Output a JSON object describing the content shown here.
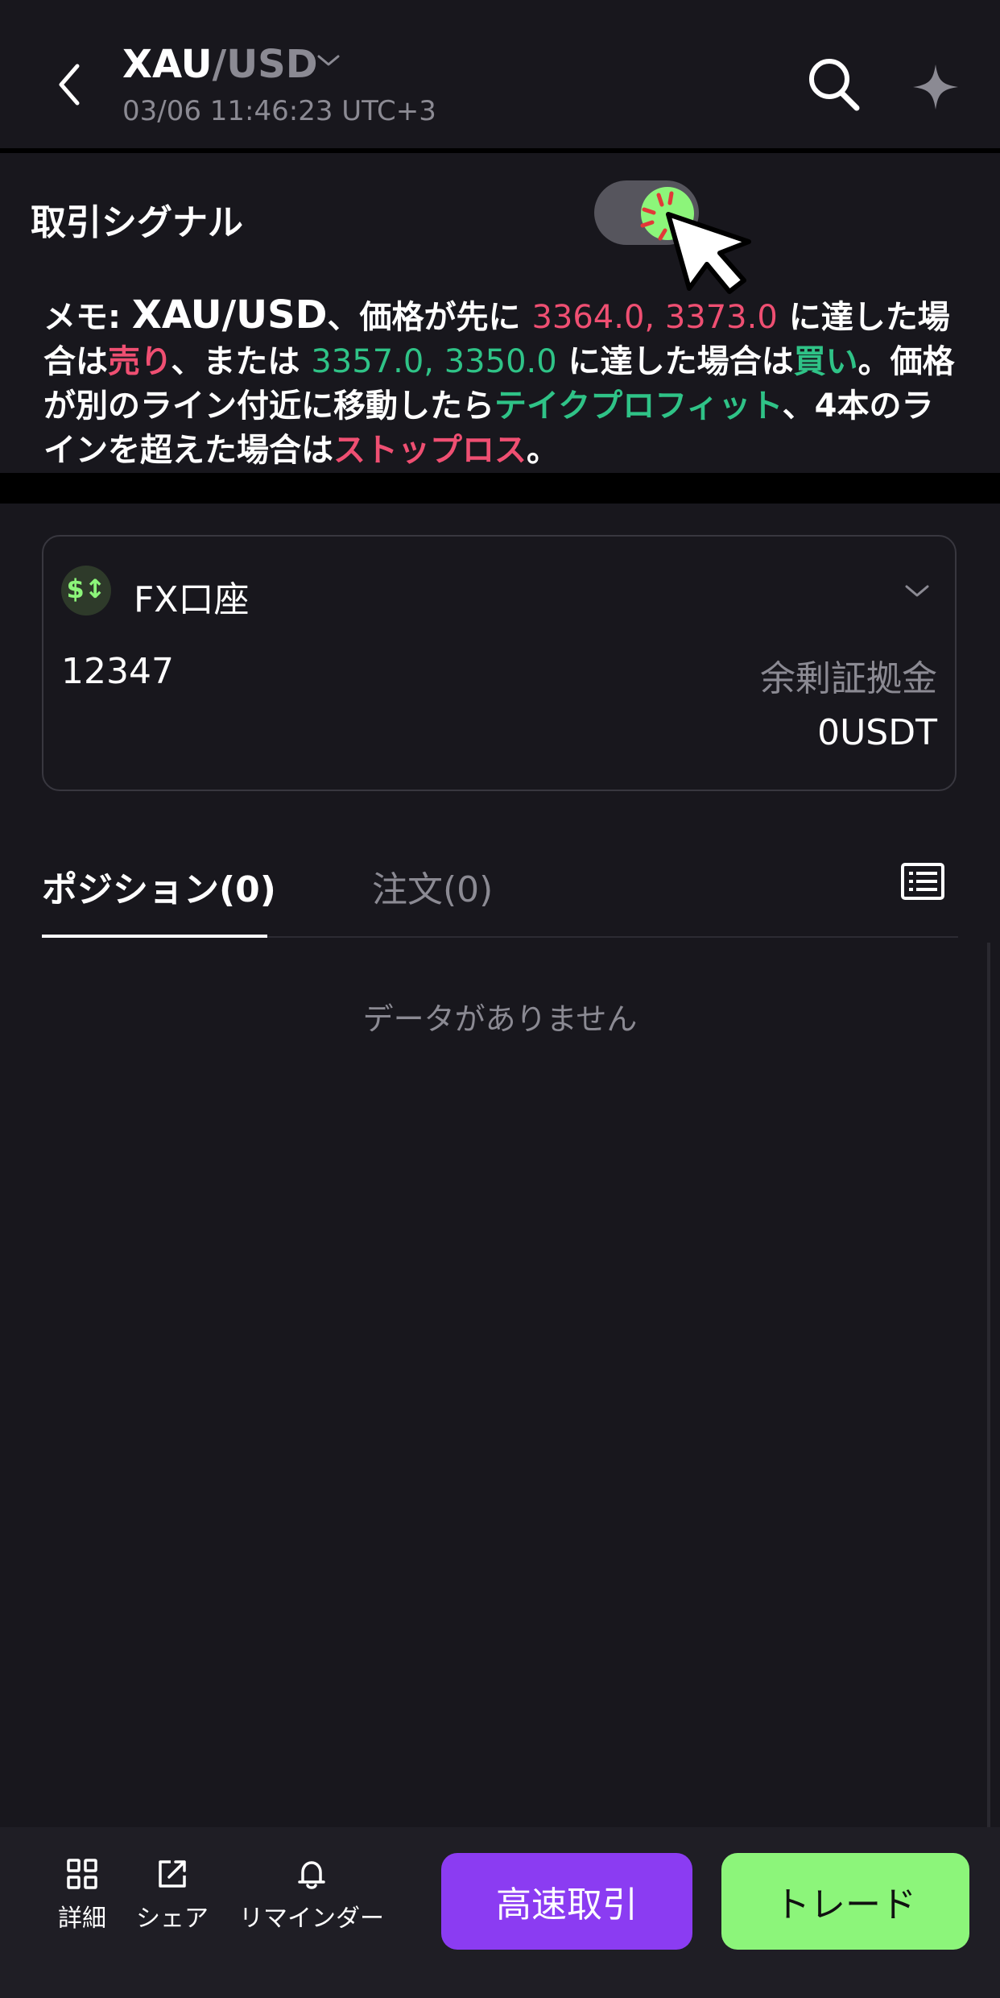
{
  "header": {
    "pair_base": "XAU",
    "pair_quote": "/USD",
    "timestamp": "03/06 11:46:23 UTC+3",
    "icons": [
      "back-arrow-icon",
      "chevron-down-icon",
      "search-icon",
      "sparkle-icon"
    ]
  },
  "signal": {
    "title": "取引シグナル",
    "toggle_on": true,
    "memo": {
      "prefix": "メモ: ",
      "pair": "XAU/USD",
      "t1": "、価格が先に ",
      "sell_prices": "3364.0, 3373.0",
      "t2": " に達した場合は",
      "sell": "売り",
      "t3": "、または ",
      "buy_prices": "3357.0, 3350.0",
      "t4": " に達した場合は",
      "buy": "買い",
      "t5": "。価格が別のライン付近に移動したら",
      "take_profit": "テイクプロフィット",
      "t6": "、4本のラインを超えた場合は",
      "stop_loss": "ストップロス",
      "t7": "。"
    }
  },
  "account": {
    "icon_text": "$↕",
    "name": "FX口座",
    "number": "12347",
    "margin_label": "余剰証拠金",
    "margin_value": "0USDT"
  },
  "tabs": {
    "positions": "ポジション(0)",
    "orders": "注文(0)",
    "empty_text": "データがありません"
  },
  "bottom": {
    "details": "詳細",
    "share": "シェア",
    "reminder": "リマインダー",
    "fast_trade": "高速取引",
    "trade": "トレード"
  },
  "colors": {
    "background": "#18171d",
    "sell_red": "#ef4f72",
    "buy_green": "#2fc387",
    "trade_green": "#8cf57a",
    "fast_purple": "#8b3cf2"
  }
}
